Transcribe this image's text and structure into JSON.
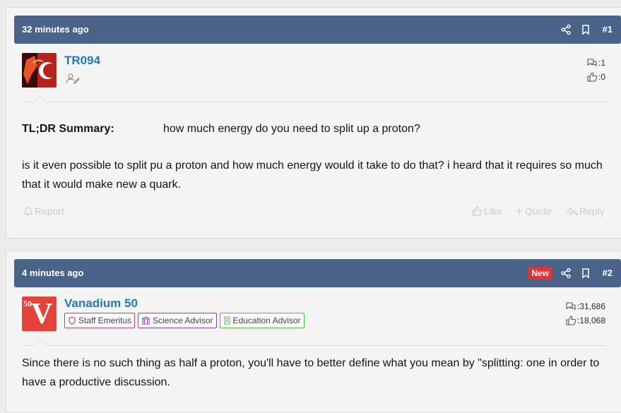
{
  "posts": [
    {
      "time": "32 minutes ago",
      "number": "#1",
      "username": "TR094",
      "stats": {
        "messages": "1",
        "reactions": "0"
      },
      "summary_label": "TL;DR Summary:",
      "summary_text": "how much energy do you need to split up a proton?",
      "body": "is it even possible to split pu a proton and how much energy would it take to do that? i heard that it requires so much that it would make new a quark.",
      "actions": {
        "report": "Report",
        "like": "Like",
        "quote": "Quote",
        "reply": "Reply"
      }
    },
    {
      "time": "4 minutes ago",
      "new_label": "New",
      "number": "#2",
      "username": "Vanadium 50",
      "avatar_text": "V",
      "avatar_number": "50",
      "badges": [
        "Staff Emeritus",
        "Science Advisor",
        "Education Advisor"
      ],
      "stats": {
        "messages": "31,686",
        "reactions": "18,068"
      },
      "body": "Since there is no such thing as half a proton, you'll have to better define what you mean by \"splitting: one in order to have a productive discussion."
    }
  ],
  "colors": {
    "header_bg": "#4a6389",
    "username": "#2577b1",
    "new_badge": "#e03434",
    "action_muted": "#c5cdd8"
  }
}
